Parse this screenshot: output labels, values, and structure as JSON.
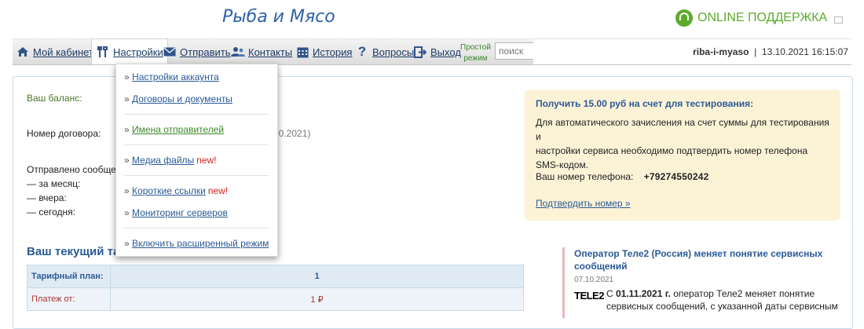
{
  "header": {
    "logo": "Рыба и Мясо",
    "support_label": "ONLINE ПОДДЕРЖКА"
  },
  "nav": {
    "items": [
      {
        "label": "Мой кабинет",
        "icon": "home-icon"
      },
      {
        "label": "Настройки",
        "icon": "settings-tools-icon"
      },
      {
        "label": "Отправить",
        "icon": "envelope-icon"
      },
      {
        "label": "Контакты",
        "icon": "contacts-icon"
      },
      {
        "label": "История",
        "icon": "calendar-icon"
      },
      {
        "label": "Вопросы",
        "icon": "question-icon"
      },
      {
        "label": "Выход",
        "icon": "logout-icon"
      }
    ],
    "simple_mode_line1": "Простой",
    "simple_mode_line2": "режим",
    "search_placeholder": "поиск",
    "username": "riba-i-myaso",
    "separator": "|",
    "datetime": "13.10.2021 16:15:07"
  },
  "dropdown": {
    "items": [
      {
        "label": "Настройки аккаунта",
        "new": ""
      },
      {
        "label": "Договоры и документы",
        "new": ""
      },
      {
        "label": "Имена отправителей",
        "new": ""
      },
      {
        "label": "Медиа файлы",
        "new": "new!"
      },
      {
        "label": "Короткие ссылки",
        "new": "new!"
      },
      {
        "label": "Мониторинг серверов",
        "new": ""
      },
      {
        "label": "Включить расширенный режим",
        "new": ""
      }
    ]
  },
  "main": {
    "balance_label": "Ваш баланс:",
    "contract_label": "Номер договора:",
    "contract_date_fragment": "10.2021)",
    "sent_label": "Отправлено сообщен",
    "sent_month": "— за месяц:",
    "sent_yesterday": "— вчера:",
    "sent_today": "— сегодня:",
    "tariff_title": "Ваш текущий та",
    "tariff_rows": [
      {
        "label": "Тарифный план:",
        "value": "1"
      },
      {
        "label": "Платеж от:",
        "value": "1 ₽"
      }
    ]
  },
  "info_box": {
    "title": "Получить 15.00 руб на счет для тестирования:",
    "text_line1": "Для автоматического зачисления на счет суммы для тестирования и",
    "text_line2": "настройки сервиса необходимо подтвердить номер телефона SMS-кодом.",
    "phone_label": "Ваш номер телефона:",
    "phone_value": "+79274550242",
    "confirm_link": "Подтвердить номер »"
  },
  "news": {
    "title": "Оператор Теле2 (Россия) меняет понятие сервисных сообщений",
    "date": "07.10.2021",
    "logo_text": "TELE2",
    "prefix": "С ",
    "bold_date": "01.11.2021 г.",
    "text": " оператор Теле2 меняет понятие сервисных сообщений, с указанной даты сервисным"
  },
  "colors": {
    "brand_blue": "#2d62a8",
    "support_green": "#5dab2e",
    "new_red": "#d42020",
    "info_bg": "#fcf3d7"
  }
}
